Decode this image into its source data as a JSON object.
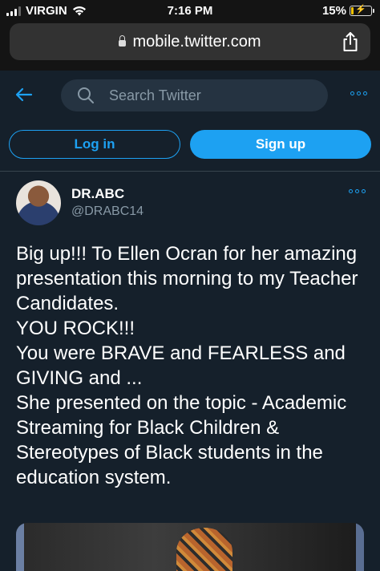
{
  "status_bar": {
    "carrier": "VIRGIN",
    "time": "7:16 PM",
    "battery_percent": "15%",
    "battery_level": 0.15
  },
  "browser": {
    "url": "mobile.twitter.com"
  },
  "header": {
    "search_placeholder": "Search Twitter"
  },
  "auth": {
    "login_label": "Log in",
    "signup_label": "Sign up"
  },
  "tweet": {
    "display_name": "DR.ABC",
    "handle": "@DRABC14",
    "text": "Big up!!! To Ellen Ocran for her amazing presentation this morning to my Teacher Candidates.\nYOU ROCK!!!\nYou were BRAVE and FEARLESS and GIVING and ...\nShe presented on the topic - Academic Streaming for Black Children & Stereotypes of Black students in the education system."
  },
  "colors": {
    "background": "#15202b",
    "accent": "#1da1f2",
    "secondary_text": "#8899a6",
    "search_bg": "#253341"
  },
  "icons": [
    "signal-icon",
    "wifi-icon",
    "battery-icon",
    "lock-icon",
    "share-icon",
    "back-arrow-icon",
    "search-icon",
    "more-icon"
  ]
}
